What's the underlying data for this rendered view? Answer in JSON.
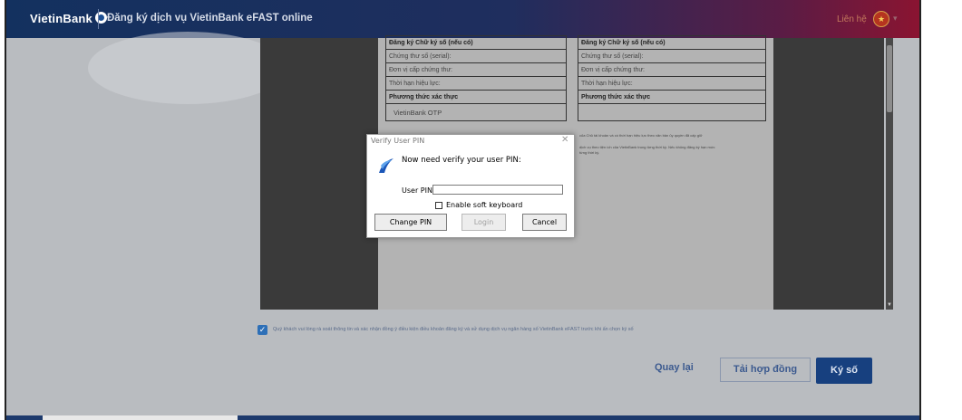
{
  "header": {
    "logo_text": "VietinBank",
    "title": "Đăng ký dịch vụ VietinBank eFAST online",
    "link": "Liên hệ",
    "lang_caret": "▾",
    "colors": {
      "start": "#13315f",
      "end": "#8a1431"
    }
  },
  "document": {
    "left_table": [
      "Đăng ký Chữ ký số (nếu có)",
      "Chứng thư số (serial):",
      "Đơn vị cấp chứng thư:",
      "Thời hạn hiệu lực:",
      "Phương thức xác thực",
      "VietinBank OTP"
    ],
    "right_table": [
      "Đăng ký Chữ ký số (nếu có)",
      "Chứng thư số (serial):",
      "Đơn vị cấp chứng thư:",
      "Thời hạn hiệu lực:",
      "Phương thức xác thực",
      ""
    ],
    "fine_print": [
      "của Chủ tài khoản và có thời hạn hiệu lực theo văn bản ủy quyền đã cấp giữ",
      "dịch vụ theo tiện ích của VietinBank trong từng thời kỳ. Nếu không đăng ký hạn mức",
      "từng thời kỳ."
    ]
  },
  "agreement": {
    "checked": true,
    "text": "Quý khách vui lòng rà soát thông tin và xác nhận đồng ý điều kiện điều khoản đăng ký và sử dụng dịch vụ ngân hàng số VietinBank eFAST trước khi ấn chọn ký số"
  },
  "actions": {
    "back": "Quay lại",
    "download": "Tải hợp đồng",
    "sign": "Ký số"
  },
  "dialog": {
    "title": "Verify User PIN",
    "close": "✕",
    "prompt": "Now need verify your user PIN:",
    "pin_label": "User PIN:",
    "pin_value": "",
    "soft_keyboard_label": "Enable soft keyboard",
    "soft_keyboard_checked": false,
    "change_pin": "Change PIN",
    "login": "Login",
    "cancel": "Cancel"
  }
}
